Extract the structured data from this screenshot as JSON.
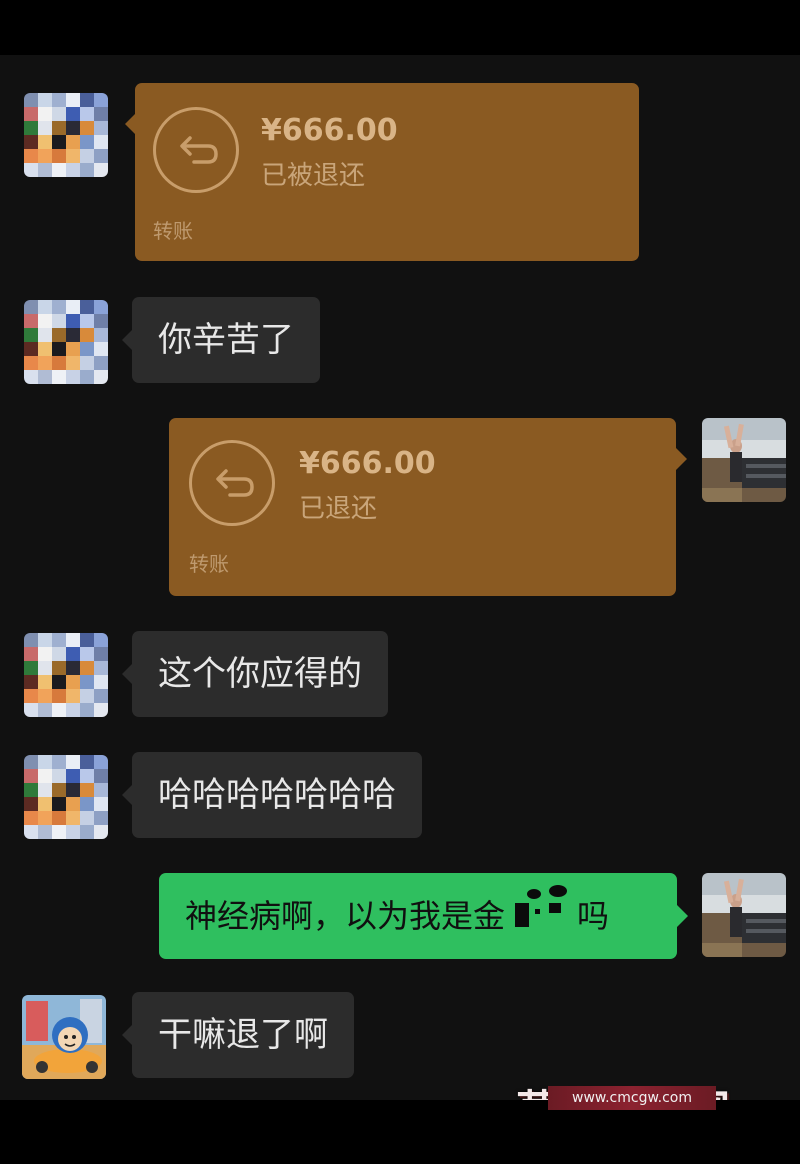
{
  "messages": {
    "m1": {
      "amount": "¥666.00",
      "status": "已被退还",
      "kind": "转账"
    },
    "m2": {
      "text": "你辛苦了"
    },
    "m3": {
      "amount": "¥666.00",
      "status": "已退还",
      "kind": "转账"
    },
    "m4": {
      "text": "这个你应得的"
    },
    "m5": {
      "text": "哈哈哈哈哈哈哈"
    },
    "m6": {
      "text_before": "神经病啊，以为我是金",
      "text_after": "吗"
    },
    "m7": {
      "text": "干嘛退了啊"
    }
  },
  "watermark": {
    "brand": "草莓吃瓜网",
    "url": "www.cmcgw.com"
  },
  "colors": {
    "transfer_bg": "#8a5a22",
    "self_bubble": "#2fbf5f",
    "other_bubble": "#2c2c2c",
    "chat_bg": "#111111"
  }
}
